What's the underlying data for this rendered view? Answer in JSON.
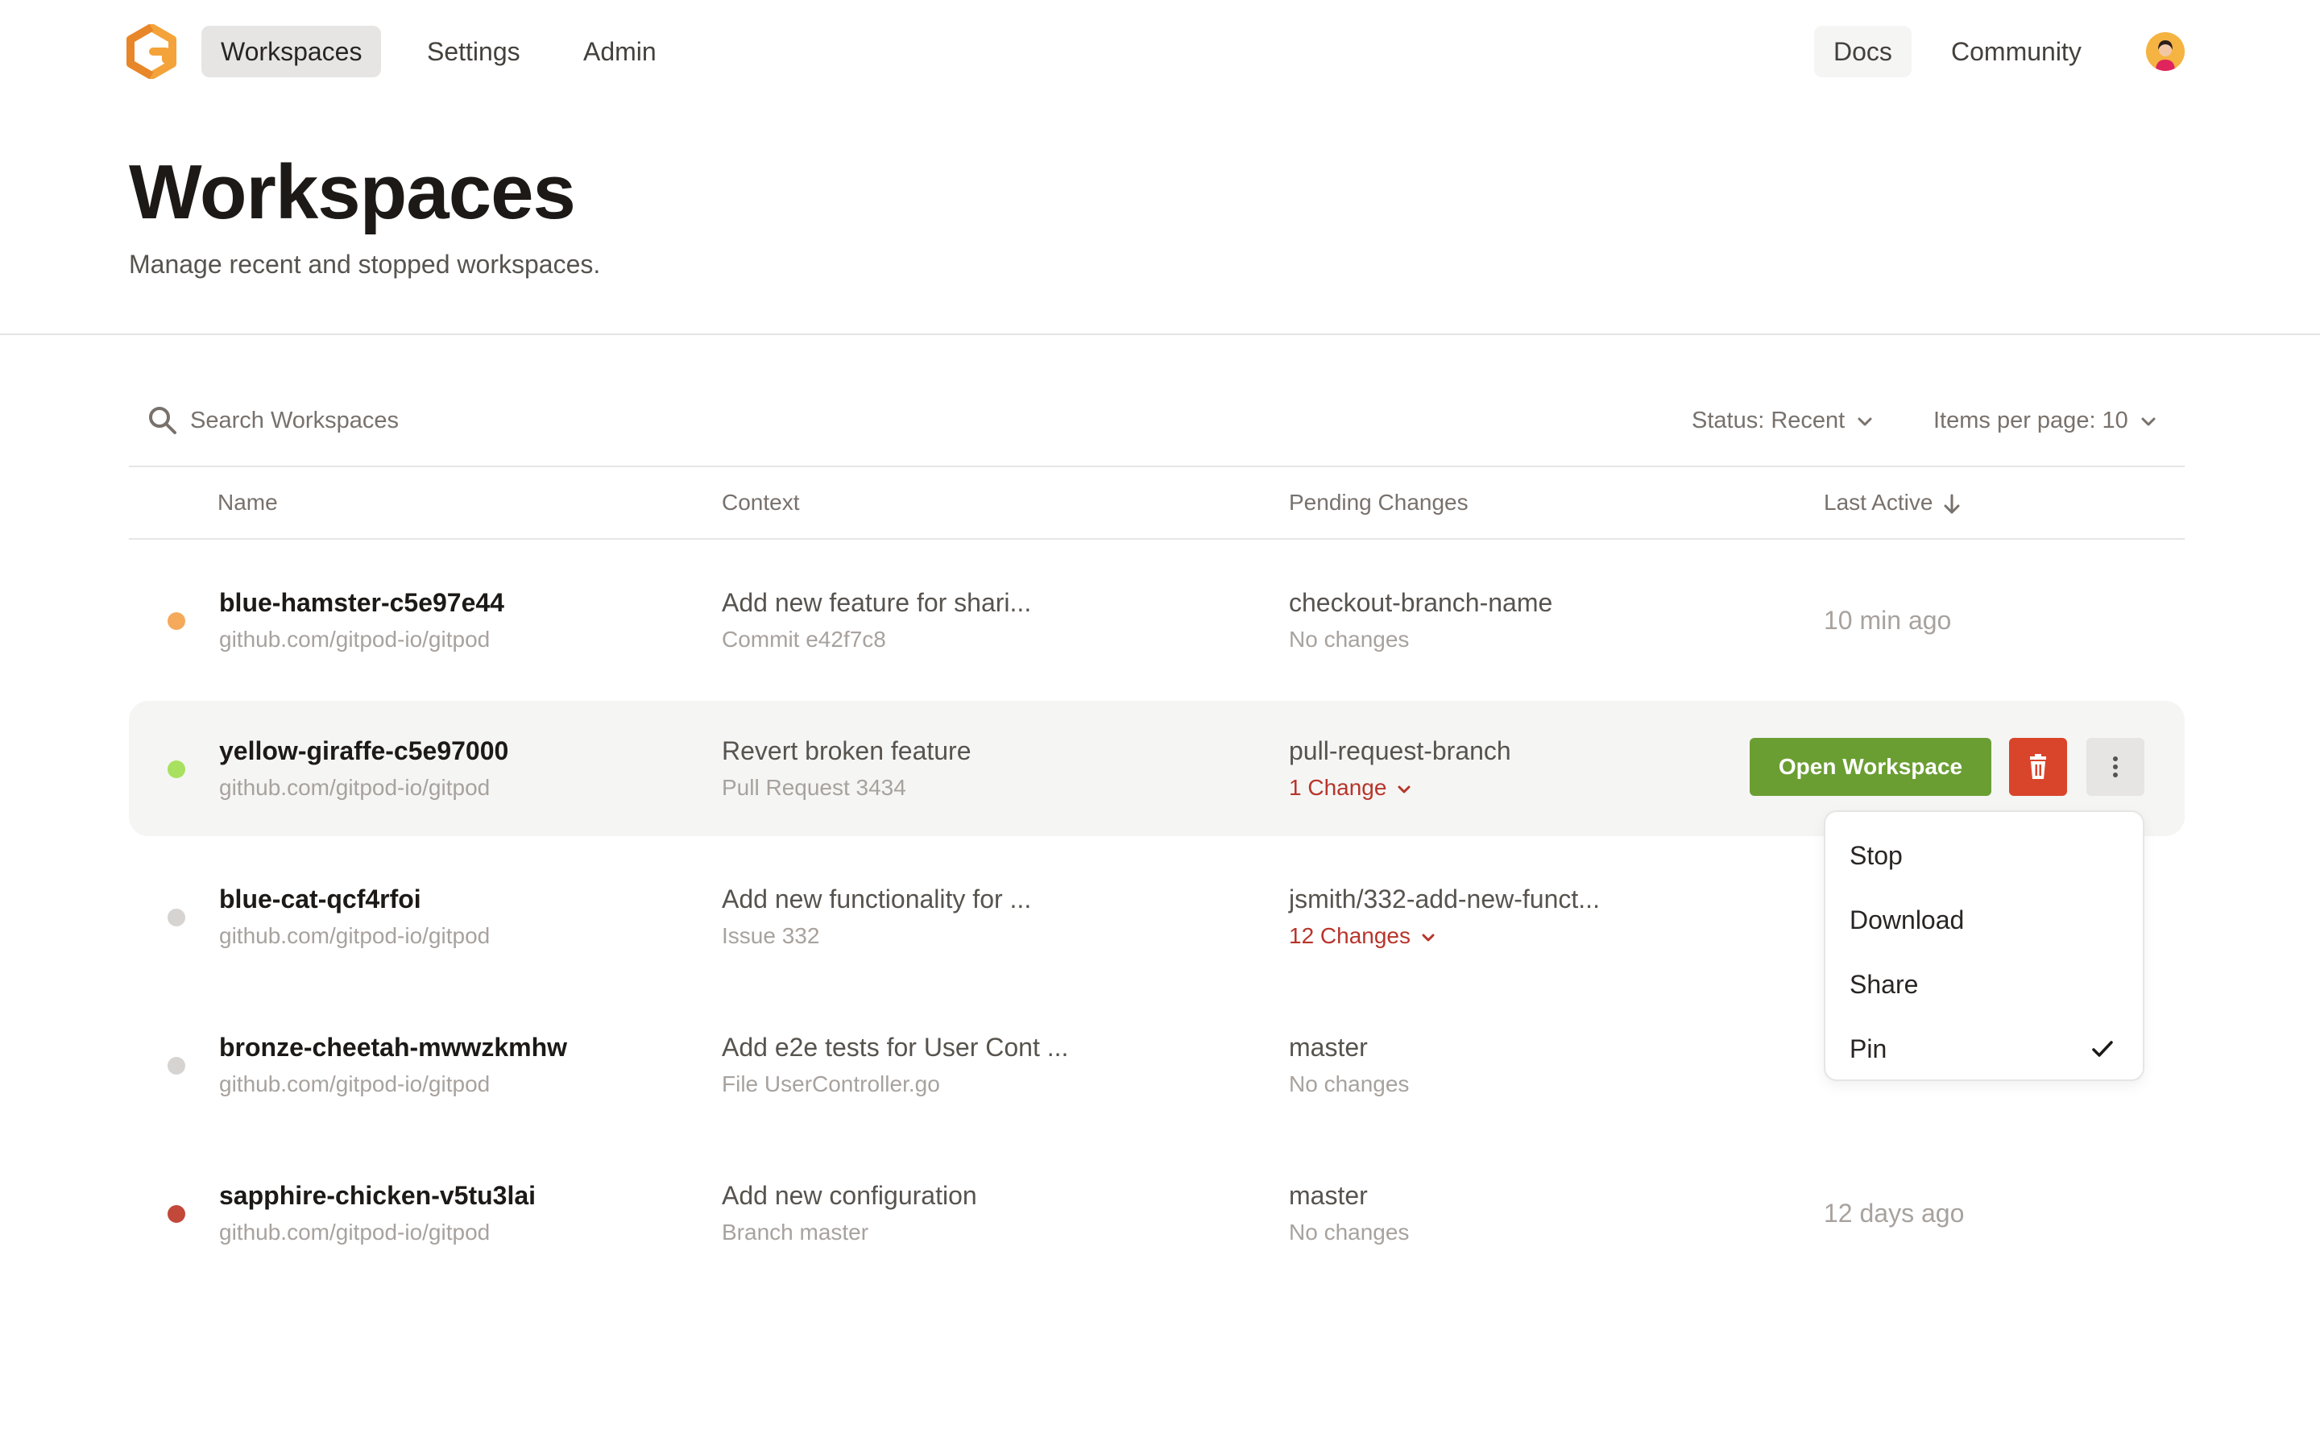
{
  "nav": {
    "left": [
      {
        "label": "Workspaces",
        "active": true
      },
      {
        "label": "Settings",
        "active": false
      },
      {
        "label": "Admin",
        "active": false
      }
    ],
    "docs": "Docs",
    "community": "Community",
    "logo_icon": "gitpod-logo",
    "avatar_icon": "user-avatar"
  },
  "header": {
    "title": "Workspaces",
    "subtitle": "Manage recent and stopped workspaces."
  },
  "toolbar": {
    "search_placeholder": "Search Workspaces",
    "status_filter": "Status: Recent",
    "items_per_page": "Items per page: 10"
  },
  "columns": {
    "name": "Name",
    "context": "Context",
    "pending": "Pending Changes",
    "last_active": "Last Active"
  },
  "colors": {
    "accent_green": "#6a9e32",
    "danger_red": "#d9452b",
    "change_red": "#b7352a",
    "status_orange": "#f5a95b",
    "status_green": "#a8e05f",
    "status_grey": "#d6d3d1",
    "status_red": "#c2483a"
  },
  "rows": [
    {
      "name": "blue-hamster-c5e97e44",
      "repo": "github.com/gitpod-io/gitpod",
      "context": "Add new feature for shari...",
      "context_sub": "Commit e42f7c8",
      "branch": "checkout-branch-name",
      "changes": "No changes",
      "last_active": "10 min ago"
    },
    {
      "name": "yellow-giraffe-c5e97000",
      "repo": "github.com/gitpod-io/gitpod",
      "context": "Revert broken feature",
      "context_sub": "Pull Request 3434",
      "branch": "pull-request-branch",
      "changes": "1 Change",
      "last_active": ""
    },
    {
      "name": "blue-cat-qcf4rfoi",
      "repo": "github.com/gitpod-io/gitpod",
      "context": "Add new functionality for ...",
      "context_sub": "Issue 332",
      "branch": "jsmith/332-add-new-funct...",
      "changes": "12 Changes",
      "last_active": ""
    },
    {
      "name": "bronze-cheetah-mwwzkmhw",
      "repo": "github.com/gitpod-io/gitpod",
      "context": "Add e2e tests for User Cont ...",
      "context_sub": "File UserController.go",
      "branch": "master",
      "changes": "No changes",
      "last_active": ""
    },
    {
      "name": "sapphire-chicken-v5tu3lai",
      "repo": "github.com/gitpod-io/gitpod",
      "context": "Add new configuration",
      "context_sub": "Branch master",
      "branch": "master",
      "changes": "No changes",
      "last_active": "12 days ago"
    }
  ],
  "actions": {
    "open_workspace": "Open Workspace"
  },
  "menu": {
    "items": [
      "Stop",
      "Download",
      "Share",
      "Pin"
    ],
    "checked": "Pin"
  }
}
